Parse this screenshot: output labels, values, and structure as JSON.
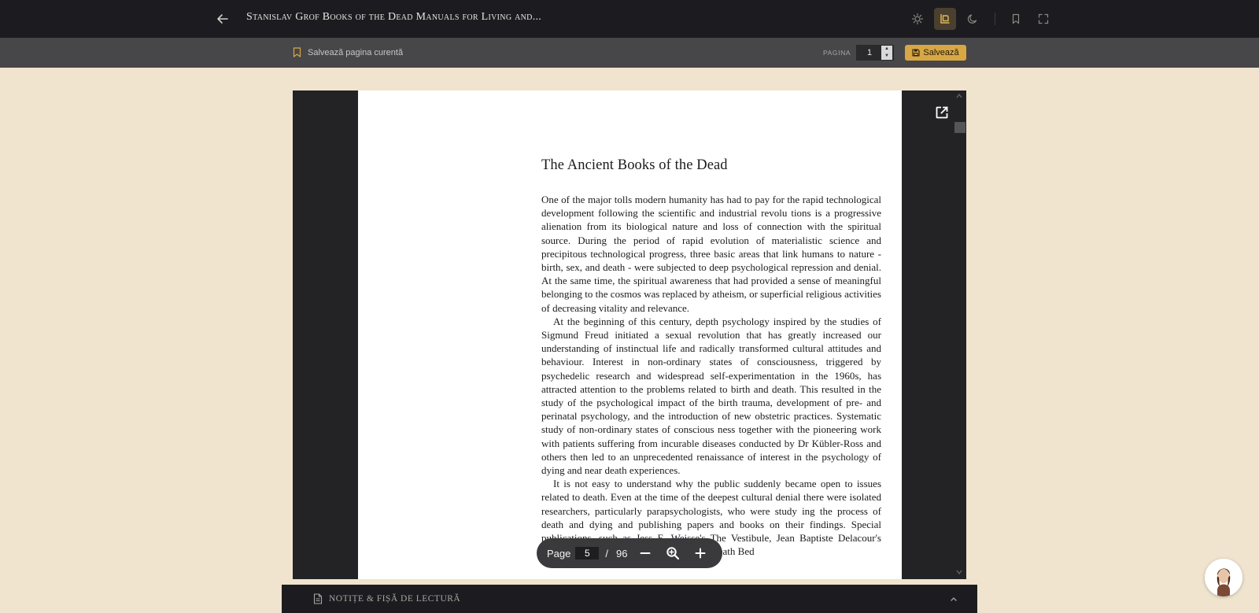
{
  "topbar": {
    "title": "Stanislav Grof Books of the Dead Manuals for Living and...",
    "icons": [
      "back-arrow-icon",
      "sun-icon",
      "sepia-mode-icon",
      "moon-icon",
      "bookmark-icon",
      "fullscreen-icon"
    ],
    "active_theme": "sepia"
  },
  "subbar": {
    "save_page_label": "Salvează pagina curentă",
    "page_label": "PAGINA",
    "page_value": "1",
    "save_label": "Salvează"
  },
  "document": {
    "chapter_title": "The Ancient Books of the Dead",
    "paragraphs": [
      "One of the major tolls modern humanity has had to pay for the rapid technological development following the scientific and industrial revolu tions is a progressive alienation from its biological nature and loss of connection with the spiritual source. During the period of rapid evolution of materialistic science and precipitous technological progress, three basic areas that link humans to nature - birth, sex, and death - were subjected to deep psychological repression and denial. At the same time, the spiritual awareness that had provided a sense of meaningful belonging to the cosmos was replaced by atheism, or superficial religious activities of decreasing vitality and relevance.",
      "At the beginning of this century, depth psychology inspired by the studies of Sigmund Freud initiated a sexual revolution that has greatly increased our understanding of instinctual life and radically transformed cultural attitudes and behaviour. Interest in non-ordinary states of consciousness, triggered by psychedelic research and widespread self-experimentation in the 1960s, has attracted attention to the problems related to birth and death. This resulted in the study of the psychological impact of the birth trauma, development of pre- and perinatal psychology, and the introduction of new obstetric practices. Systematic study of non-ordinary states of conscious ness together with the pioneering work with patients suffering from incurable diseases conducted by Dr Kübler-Ross and others then led to an unprecedented renaissance of interest in the psychology of dying and near death experiences.",
      "It is not easy to understand why the public suddenly became open to issues related to death. Even at the time of the deepest cultural denial there were isolated researchers, particularly parapsychologists, who were study ing the process of death and dying and publishing papers and books on their findings. Special publications, such as Jess E. Weisse's The Vestibule, Jean Baptiste Delacour's Glimpses of the Beyond, or Karlis Osis's Death Bed"
    ]
  },
  "pager": {
    "page_word": "Page",
    "current": "5",
    "separator": "/",
    "total": "96"
  },
  "notes": {
    "label": "NOTIȚE & FIȘĂ DE LECTURĂ"
  },
  "colors": {
    "topbar": "#1c1c20",
    "subbar": "#47474a",
    "background": "#f0e4cf",
    "accent": "#d8a744",
    "viewer": "#232326"
  }
}
